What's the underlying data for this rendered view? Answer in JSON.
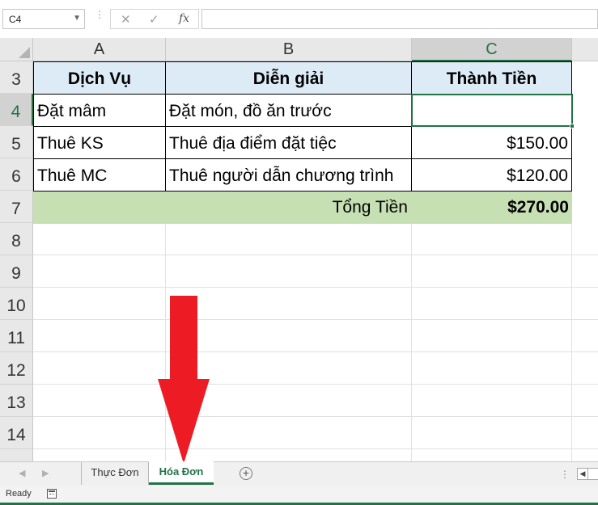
{
  "formula_bar": {
    "name_box": "C4",
    "cancel_icon": "✕",
    "enter_icon": "✓",
    "fx_icon": "fx",
    "formula_value": ""
  },
  "columns": [
    "A",
    "B",
    "C"
  ],
  "rows": [
    "3",
    "4",
    "5",
    "6",
    "7",
    "8",
    "9",
    "10",
    "11",
    "12",
    "13",
    "14"
  ],
  "table": {
    "headers": [
      "Dịch Vụ",
      "Diễn giải",
      "Thành Tiền"
    ],
    "rows": [
      {
        "service": "Đặt mâm",
        "description": "Đặt món, đồ ăn trước",
        "amount": ""
      },
      {
        "service": "Thuê KS",
        "description": "Thuê địa điểm đặt tiệc",
        "amount": "$150.00"
      },
      {
        "service": "Thuê MC",
        "description": "Thuê người dẫn chương trình",
        "amount": "$120.00"
      }
    ],
    "total_label": "Tổng Tiền",
    "total_value": "$270.00"
  },
  "sheet_tabs": {
    "tabs": [
      "Thực Đơn",
      "Hóa Đơn"
    ],
    "active": "Hóa Đơn",
    "add_label": "+"
  },
  "status_bar": {
    "status": "Ready"
  },
  "colors": {
    "excel_green": "#217346",
    "header_fill": "#dcebf6",
    "total_fill": "#c6e0b4",
    "arrow_red": "#ed1c24"
  }
}
